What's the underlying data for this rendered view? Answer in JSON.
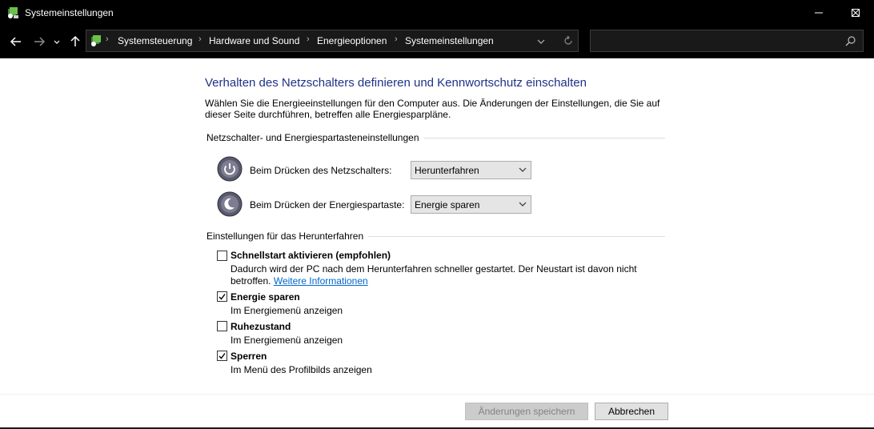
{
  "window": {
    "title": "Systemeinstellungen",
    "icon": "control-panel-icon",
    "controls": [
      "minimize-icon",
      "maximize-icon",
      "close-icon"
    ]
  },
  "navigation": {
    "back_icon": "arrow-left-icon",
    "forward_icon": "arrow-right-icon",
    "recent_icon": "chevron-down-icon",
    "up_icon": "arrow-up-icon",
    "breadcrumbs": [
      "Systemsteuerung",
      "Hardware und Sound",
      "Energieoptionen",
      "Systemeinstellungen"
    ],
    "search": {
      "placeholder": "",
      "value": ""
    }
  },
  "page": {
    "title": "Verhalten des Netzschalters definieren und Kennwortschutz einschalten",
    "description": "Wählen Sie die Energieeinstellungen für den Computer aus. Die Änderungen der Einstellungen, die Sie auf dieser Seite durchführen, betreffen alle Energiesparpläne."
  },
  "buttons_section": {
    "header": "Netzschalter- und Energiespartasteneinstellungen",
    "power_button": {
      "label": "Beim Drücken des Netzschalters:",
      "value": "Herunterfahren",
      "icon": "power-button-icon"
    },
    "sleep_button": {
      "label": "Beim Drücken der Energiespartaste:",
      "value": "Energie sparen",
      "icon": "sleep-button-icon"
    }
  },
  "shutdown_section": {
    "header": "Einstellungen für das Herunterfahren",
    "items": [
      {
        "label": "Schnellstart aktivieren (empfohlen)",
        "checked": false,
        "description": "Dadurch wird der PC nach dem Herunterfahren schneller gestartet. Der Neustart ist davon nicht betroffen.",
        "link": "Weitere Informationen"
      },
      {
        "label": "Energie sparen",
        "checked": true,
        "description": "Im Energiemenü anzeigen"
      },
      {
        "label": "Ruhezustand",
        "checked": false,
        "description": "Im Energiemenü anzeigen"
      },
      {
        "label": "Sperren",
        "checked": true,
        "description": "Im Menü des Profilbilds anzeigen"
      }
    ]
  },
  "footer": {
    "save_label": "Änderungen speichern",
    "save_enabled": false,
    "cancel_label": "Abbrechen"
  },
  "colors": {
    "titlebar": "#000000",
    "heading": "#1e3287",
    "link": "#0066cc"
  }
}
